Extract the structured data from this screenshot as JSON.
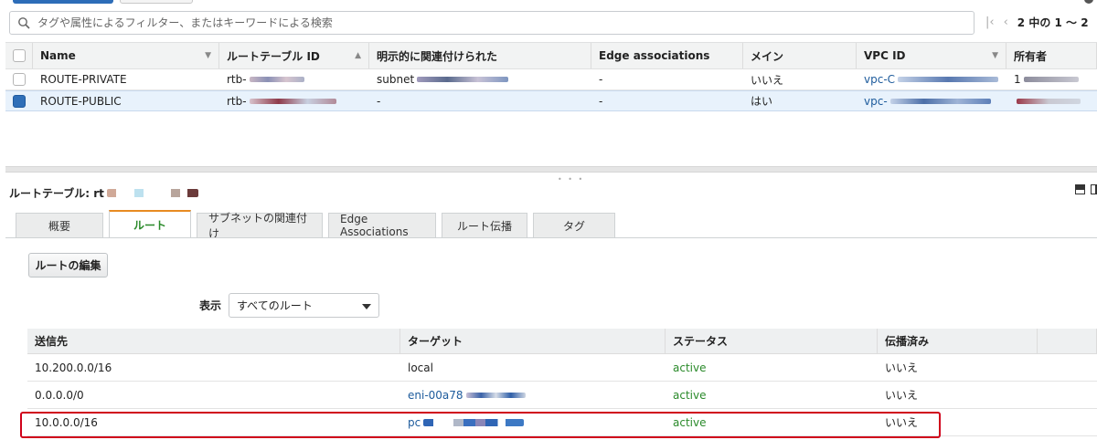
{
  "search": {
    "placeholder": "タグや属性によるフィルター、またはキーワードによる検索"
  },
  "pager": {
    "text": "2 中の 1 〜 2"
  },
  "route_tables": {
    "columns": [
      "Name",
      "ルートテーブル ID",
      "明示的に関連付けられた",
      "Edge associations",
      "メイン",
      "VPC ID",
      "所有者"
    ],
    "rows": [
      {
        "name": "ROUTE-PRIVATE",
        "id": "rtb-",
        "assoc": "subnet",
        "edge": "-",
        "main": "いいえ",
        "vpc": "vpc-C",
        "owner": "1",
        "selected": false
      },
      {
        "name": "ROUTE-PUBLIC",
        "id": "rtb-",
        "assoc": "-",
        "edge": "-",
        "main": "はい",
        "vpc": "vpc-",
        "owner": "",
        "selected": true
      }
    ]
  },
  "detail": {
    "label": "ルートテーブル: rt",
    "tabs": [
      "概要",
      "ルート",
      "サブネットの関連付け",
      "Edge Associations",
      "ルート伝播",
      "タグ"
    ],
    "active_tab": 1,
    "edit_button": "ルートの編集",
    "filter_label": "表示",
    "filter_value": "すべてのルート"
  },
  "routes": {
    "columns": [
      "送信先",
      "ターゲット",
      "ステータス",
      "伝播済み"
    ],
    "rows": [
      {
        "dest": "10.200.0.0/16",
        "target": "local",
        "target_link": false,
        "status": "active",
        "propagated": "いいえ"
      },
      {
        "dest": "0.0.0.0/0",
        "target": "eni-00a78",
        "target_link": true,
        "status": "active",
        "propagated": "いいえ"
      },
      {
        "dest": "10.0.0.0/16",
        "target": "pc",
        "target_link": true,
        "status": "active",
        "propagated": "いいえ"
      }
    ]
  },
  "colors": {
    "accent": "#e88b22",
    "link": "#1d5b9c",
    "active": "#2a8a2a",
    "highlight": "#d0021b",
    "selected_row": "#e8f2fc"
  }
}
